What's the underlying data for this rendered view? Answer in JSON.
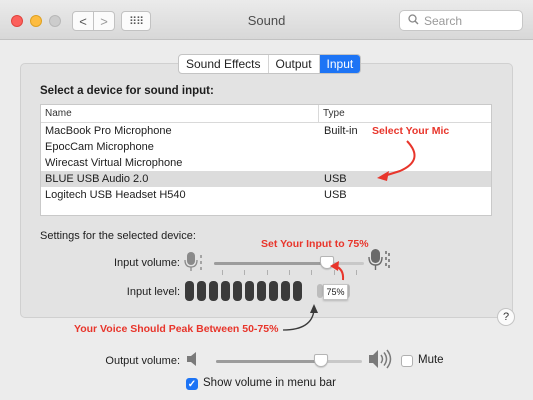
{
  "window": {
    "title": "Sound",
    "search_placeholder": "Search",
    "grid_glyph": "⠿⠿",
    "back_glyph": "<",
    "forward_glyph": ">"
  },
  "tabs": [
    {
      "label": "Sound Effects",
      "active": false
    },
    {
      "label": "Output",
      "active": false
    },
    {
      "label": "Input",
      "active": true
    }
  ],
  "input": {
    "heading": "Select a device for sound input:",
    "columns": [
      "Name",
      "Type"
    ],
    "devices": [
      {
        "name": "MacBook Pro Microphone",
        "type": "Built-in",
        "selected": false
      },
      {
        "name": "EpocCam Microphone",
        "type": "",
        "selected": false
      },
      {
        "name": "Wirecast Virtual Microphone",
        "type": "",
        "selected": false
      },
      {
        "name": "BLUE USB Audio 2.0",
        "type": "USB",
        "selected": true
      },
      {
        "name": "Logitech USB Headset H540",
        "type": "USB",
        "selected": false
      }
    ],
    "settings_label": "Settings for the selected device:",
    "volume_label": "Input volume:",
    "volume_value": 0.75,
    "level_label": "Input level:",
    "level_segments_total": 15,
    "level_segments_on": 11,
    "tooltip": "75%"
  },
  "annotations": {
    "select_mic": "Select Your Mic",
    "set_input": "Set Your Input to 75%",
    "peak": "Your Voice Should Peak Between 50-75%",
    "color": "#e8352b"
  },
  "output": {
    "volume_label": "Output volume:",
    "volume_value": 0.72,
    "mute_label": "Mute",
    "mute_checked": false,
    "show_volume_label": "Show volume in menu bar",
    "show_volume_checked": true
  },
  "help_label": "?",
  "colors": {
    "accent": "#1d74f5",
    "annotation": "#e8352b"
  }
}
